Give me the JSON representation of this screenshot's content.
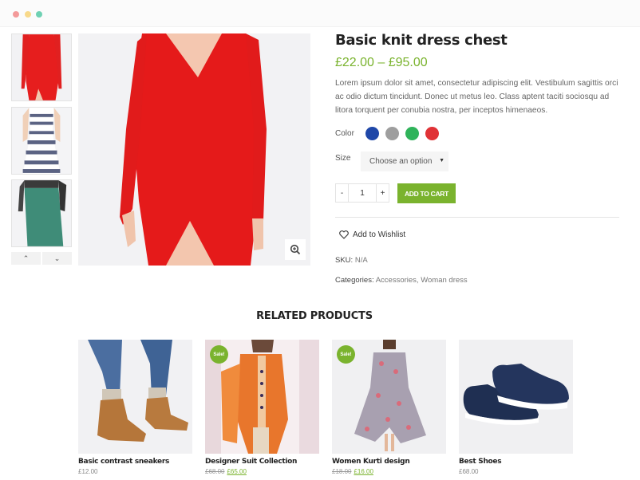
{
  "window": {
    "controls": [
      "close",
      "minimize",
      "maximize"
    ]
  },
  "gallery": {
    "thumbnails": [
      {
        "alt": "Red knit dress thumbnail"
      },
      {
        "alt": "Striped dress thumbnail"
      },
      {
        "alt": "Green maxi skirt thumbnail"
      }
    ],
    "prev_icon": "chevron-up-icon",
    "next_icon": "chevron-down-icon",
    "main_alt": "Red long-sleeve knit dress",
    "zoom_icon": "zoom-in-icon"
  },
  "product": {
    "title": "Basic knit dress chest",
    "price": "£22.00 – £95.00",
    "description": "Lorem ipsum dolor sit amet, consectetur adipiscing elit. Vestibulum sagittis orci ac odio dictum tincidunt. Donec ut metus leo. Class aptent taciti sociosqu ad litora torquent per conubia nostra, per inceptos himenaeos.",
    "color_label": "Color",
    "colors": [
      {
        "name": "Blue",
        "hex": "#1f47a8"
      },
      {
        "name": "Grey",
        "hex": "#9e9e9e"
      },
      {
        "name": "Green",
        "hex": "#2fb35a"
      },
      {
        "name": "Red",
        "hex": "#e03236"
      }
    ],
    "size_label": "Size",
    "size_select": "Choose an option",
    "qty_minus": "-",
    "qty_value": "1",
    "qty_plus": "+",
    "add_to_cart": "ADD TO CART",
    "wishlist": "Add to Wishlist",
    "sku_label": "SKU:",
    "sku_value": "N/A",
    "categories_label": "Categories:",
    "categories_value": "Accessories, Woman dress"
  },
  "related": {
    "title": "RELATED PRODUCTS",
    "items": [
      {
        "name": "Basic contrast sneakers",
        "price": "£12.00",
        "old_price": "",
        "sale": ""
      },
      {
        "name": "Designer Suit Collection",
        "price": "£65.00",
        "old_price": "£68.00",
        "sale": "Sale!"
      },
      {
        "name": "Women Kurti design",
        "price": "£16.00",
        "old_price": "£18.00",
        "sale": "Sale!"
      },
      {
        "name": "Best Shoes",
        "price": "£68.00",
        "old_price": "",
        "sale": ""
      }
    ]
  },
  "colors": {
    "accent": "#7ab32e"
  }
}
